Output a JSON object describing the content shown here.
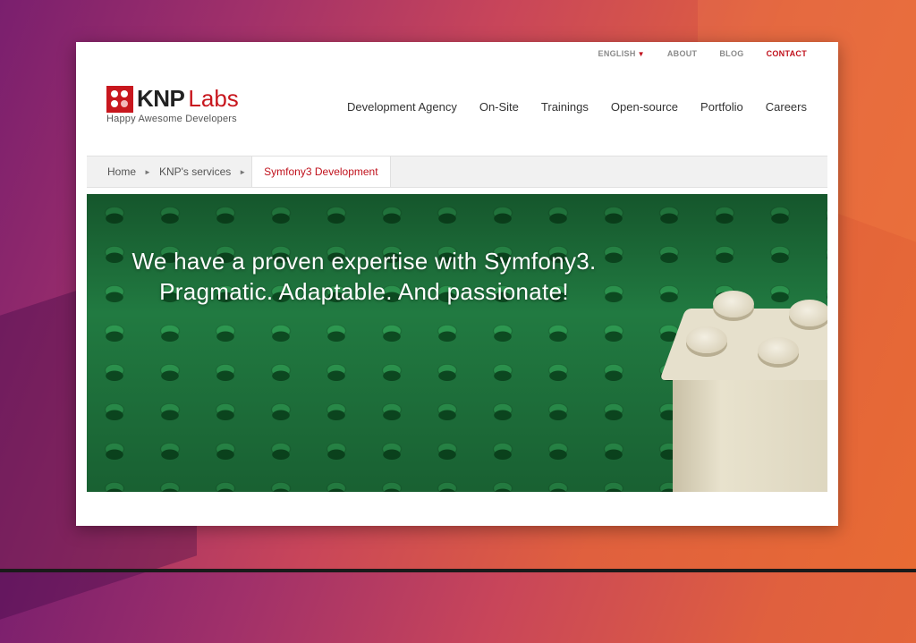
{
  "topnav": {
    "language": "ENGLISH",
    "about": "ABOUT",
    "blog": "BLOG",
    "contact": "CONTACT"
  },
  "logo": {
    "strong": "KNP",
    "light": "Labs",
    "tagline": "Happy Awesome Developers"
  },
  "mainnav": {
    "items": [
      "Development Agency",
      "On-Site",
      "Trainings",
      "Open-source",
      "Portfolio",
      "Careers"
    ]
  },
  "breadcrumb": {
    "home": "Home",
    "services": "KNP's services",
    "current": "Symfony3 Development"
  },
  "hero": {
    "line1": "We have a proven expertise with Symfony3.",
    "line2": "Pragmatic. Adaptable. And passionate!"
  },
  "colors": {
    "brand_red": "#c8171e",
    "hero_green": "#217a41"
  },
  "icons": {
    "caret": "caret-down-icon",
    "breadcrumb_sep": "triangle-right-icon"
  }
}
